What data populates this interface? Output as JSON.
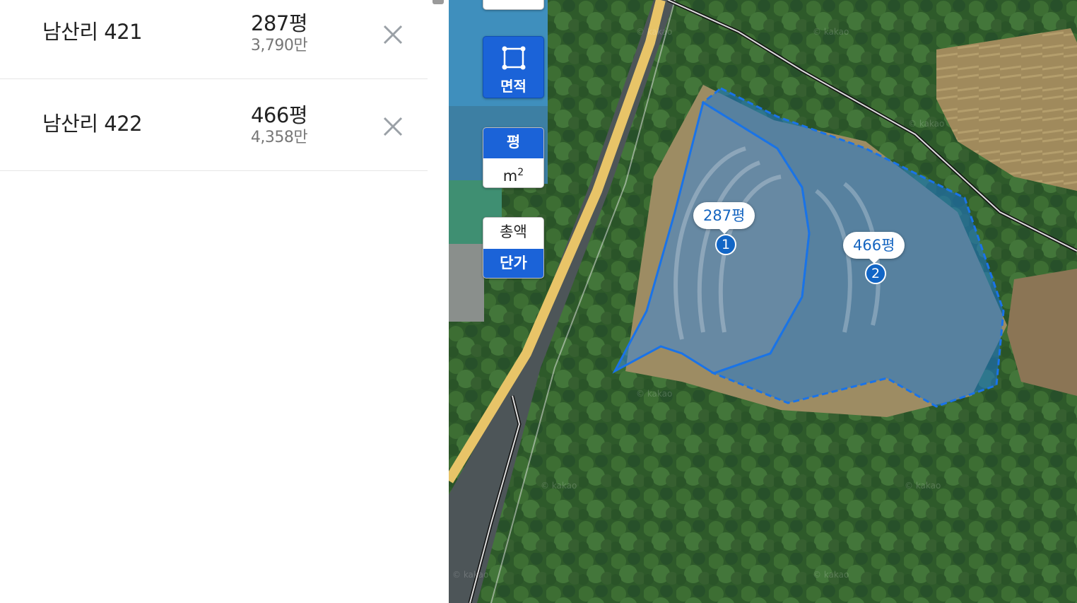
{
  "list": {
    "items": [
      {
        "name": "남산리 421",
        "area": "287평",
        "price": "3,790만"
      },
      {
        "name": "남산리 422",
        "area": "466평",
        "price": "4,358만"
      }
    ]
  },
  "map": {
    "controls": {
      "area_tool_label": "면적",
      "unit_pyeong": "평",
      "unit_m2_base": "m",
      "unit_m2_sup": "2",
      "price_total": "총액",
      "price_unit": "단가"
    },
    "parcels": [
      {
        "label": "287평",
        "number": "1"
      },
      {
        "label": "466평",
        "number": "2"
      }
    ],
    "watermark": "© kakao",
    "colors": {
      "accent": "#1b63d8",
      "parcel_fill": "#1e78d2",
      "road": "#e8c468"
    }
  }
}
